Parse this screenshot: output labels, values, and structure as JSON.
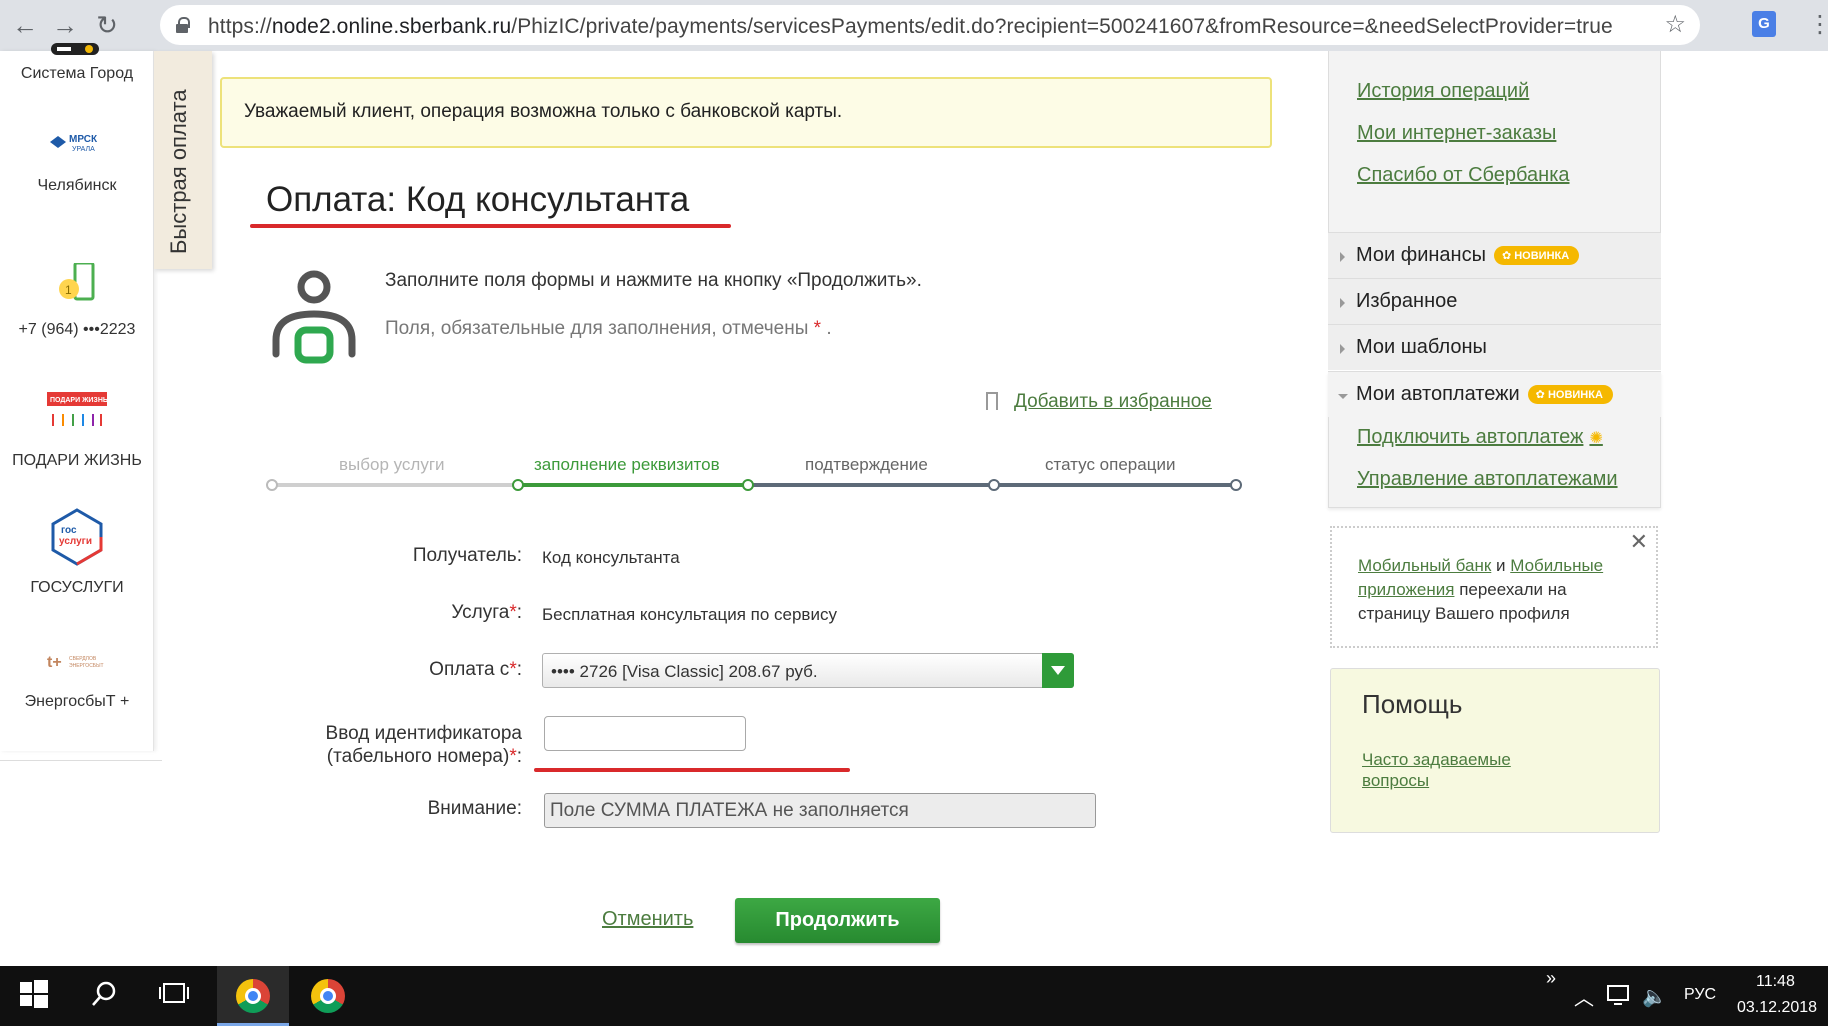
{
  "browser": {
    "url_prefix": "https://",
    "url_host": "node2.online.sberbank.ru",
    "url_path": "/PhizIC/private/payments/servicesPayments/edit.do?recipient=500241607&fromResource=&needSelectProvider=true"
  },
  "left_services": [
    {
      "name": "Система Город"
    },
    {
      "name": "Челябинск"
    },
    {
      "name": "+7 (964) •••2223"
    },
    {
      "name": "ПОДАРИ ЖИЗНЬ"
    },
    {
      "name": "ГОСУСЛУГИ"
    },
    {
      "name": "ЭнергосбыТ +"
    }
  ],
  "quick_pay_tab": "Быстрая оплата",
  "notice": "Уважаемый клиент, операция возможна только с банковской карты.",
  "page_title": "Оплата: Код консультанта",
  "instructions": {
    "line1": "Заполните поля формы и нажмите на кнопку «Продолжить».",
    "line2": "Поля, обязательные для заполнения, отмечены",
    "req_mark": "*",
    "line2_end": "."
  },
  "favorite_link": "Добавить в избранное",
  "steps": [
    {
      "label": "выбор услуги",
      "state": "done"
    },
    {
      "label": "заполнение реквизитов",
      "state": "active"
    },
    {
      "label": "подтверждение",
      "state": "pending"
    },
    {
      "label": "статус операции",
      "state": "pending"
    }
  ],
  "form": {
    "recipient_label": "Получатель:",
    "recipient_value": "Код консультанта",
    "service_label": "Услуга",
    "service_value": "Бесплатная консультация по сервису",
    "payfrom_label": "Оплата с",
    "payfrom_value": "•••• 2726 [Visa Classic] 208.67 руб.",
    "id_label_line1": "Ввод идентификатора",
    "id_label_line2": "(табельного номера)",
    "id_value": "",
    "attention_label": "Внимание:",
    "attention_value": "Поле СУММА ПЛАТЕЖА не заполняется",
    "req_mark": "*",
    "colon": ":"
  },
  "buttons": {
    "cancel": "Отменить",
    "continue": "Продолжить"
  },
  "sidebar": {
    "links": [
      "История операций",
      "Мои интернет-заказы",
      "Спасибо от Сбербанка"
    ],
    "menu": [
      {
        "label": "Мои финансы",
        "badge": "НОВИНКА"
      },
      {
        "label": "Избранное"
      },
      {
        "label": "Мои шаблоны"
      },
      {
        "label": "Мои автоплатежи",
        "badge": "НОВИНКА"
      }
    ],
    "autopay_links": [
      "Подключить автоплатеж",
      "Управление автоплатежами"
    ],
    "mobile_notice": {
      "link1": "Мобильный банк",
      "and": "и",
      "link2": "Мобильные приложения",
      "rest": "переехали на страницу Вашего профиля"
    },
    "help": {
      "title": "Помощь",
      "link": "Часто задаваемые вопросы"
    }
  },
  "taskbar": {
    "lang": "РУС",
    "time": "11:48",
    "date": "03.12.2018"
  },
  "colors": {
    "brand_green": "#2f9b39",
    "link_green": "#4c7c3f",
    "required_red": "#d9292b",
    "badge_yellow": "#f5b800"
  }
}
